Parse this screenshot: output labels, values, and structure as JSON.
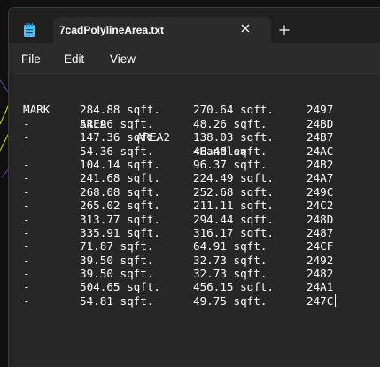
{
  "tab": {
    "title": "7cadPolylineArea.txt"
  },
  "menu": {
    "file": "File",
    "edit": "Edit",
    "view": "View"
  },
  "document": {
    "header": {
      "mark": "MARK",
      "area": "AREA",
      "area2": "AREA2",
      "handle": "<Handle>"
    },
    "rows": [
      {
        "mark": "-",
        "area": "284.88 sqft.",
        "area2": "270.64 sqft.",
        "handle": "2497"
      },
      {
        "mark": "-",
        "area": "54.96 sqft.",
        "area2": "48.26 sqft.",
        "handle": "24BD"
      },
      {
        "mark": "-",
        "area": "147.36 sqft.",
        "area2": "138.03 sqft.",
        "handle": "24B7"
      },
      {
        "mark": "-",
        "area": "54.36 sqft.",
        "area2": "46.40 sqft.",
        "handle": "24AC"
      },
      {
        "mark": "-",
        "area": "104.14 sqft.",
        "area2": "96.37 sqft.",
        "handle": "24B2"
      },
      {
        "mark": "-",
        "area": "241.68 sqft.",
        "area2": "224.49 sqft.",
        "handle": "24A7"
      },
      {
        "mark": "-",
        "area": "268.08 sqft.",
        "area2": "252.68 sqft.",
        "handle": "249C"
      },
      {
        "mark": "-",
        "area": "265.02 sqft.",
        "area2": "211.11 sqft.",
        "handle": "24C2"
      },
      {
        "mark": "-",
        "area": "313.77 sqft.",
        "area2": "294.44 sqft.",
        "handle": "248D"
      },
      {
        "mark": "-",
        "area": "335.91 sqft.",
        "area2": "316.17 sqft.",
        "handle": "2487"
      },
      {
        "mark": "-",
        "area": "71.87 sqft.",
        "area2": "64.91 sqft.",
        "handle": "24CF"
      },
      {
        "mark": "-",
        "area": "39.50 sqft.",
        "area2": "32.73 sqft.",
        "handle": "2492"
      },
      {
        "mark": "-",
        "area": "39.50 sqft.",
        "area2": "32.73 sqft.",
        "handle": "2482"
      },
      {
        "mark": "-",
        "area": "504.65 sqft.",
        "area2": "456.15 sqft.",
        "handle": "24A1"
      },
      {
        "mark": "-",
        "area": "54.81 sqft.",
        "area2": "49.75 sqft.",
        "handle": "247C"
      }
    ]
  },
  "icons": {
    "app": "notepad-icon",
    "close": "close-icon",
    "new_tab": "plus-icon"
  },
  "colors": {
    "accent": "#4cc2ff",
    "polyline": "#e6e600"
  }
}
